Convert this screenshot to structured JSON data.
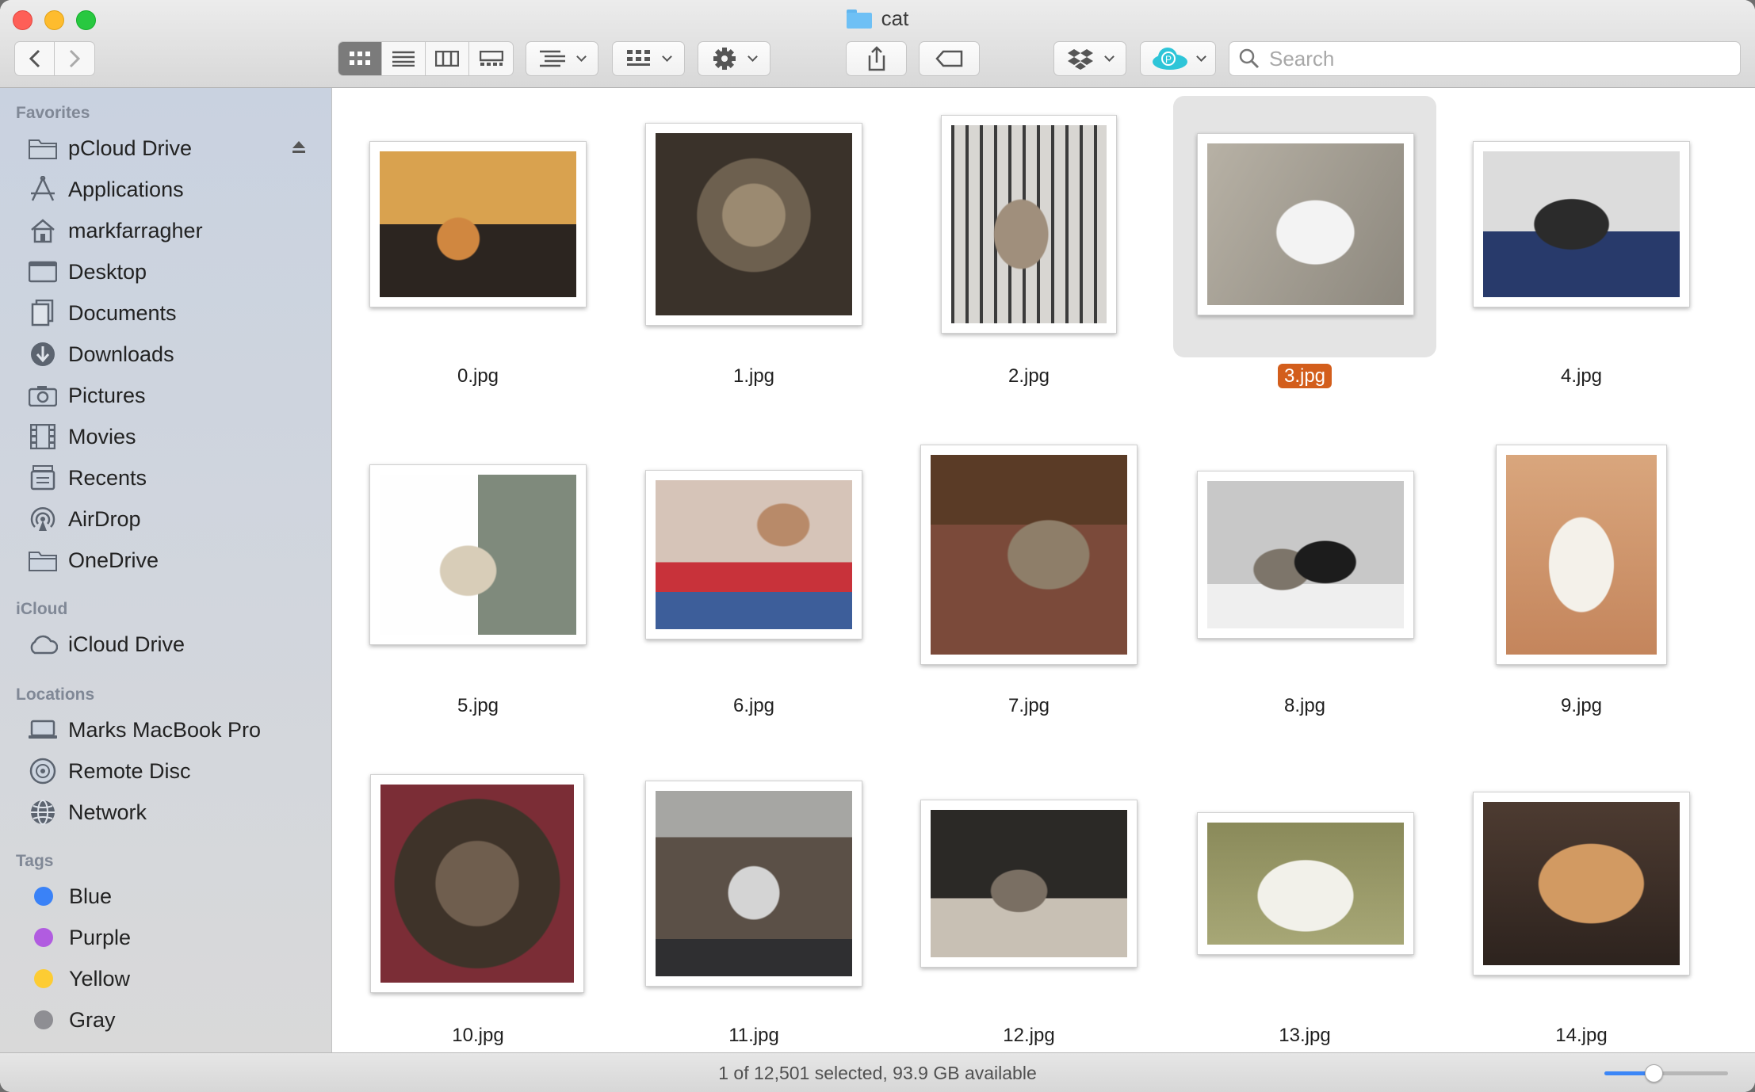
{
  "window": {
    "title": "cat"
  },
  "toolbar": {
    "back_icon": "chevron-left-icon",
    "forward_icon": "chevron-right-icon",
    "view_modes": [
      "icon-view-icon",
      "list-view-icon",
      "column-view-icon",
      "gallery-view-icon"
    ],
    "active_view": "icon",
    "group_icon": "group-by-icon",
    "arrange_icon": "arrange-icon",
    "action_icon": "gear-icon",
    "share_icon": "share-icon",
    "tag_icon": "tag-icon",
    "dropbox_icon": "dropbox-icon",
    "pcloud_icon": "pcloud-icon",
    "search_placeholder": "Search"
  },
  "sidebar": {
    "favorites_header": "Favorites",
    "favorites": [
      {
        "label": "pCloud Drive",
        "icon": "folder-icon"
      },
      {
        "label": "Applications",
        "icon": "applications-icon"
      },
      {
        "label": "markfarragher",
        "icon": "home-icon"
      },
      {
        "label": "Desktop",
        "icon": "desktop-icon"
      },
      {
        "label": "Documents",
        "icon": "document-icon"
      },
      {
        "label": "Downloads",
        "icon": "download-icon"
      },
      {
        "label": "Pictures",
        "icon": "camera-icon"
      },
      {
        "label": "Movies",
        "icon": "film-icon"
      },
      {
        "label": "Recents",
        "icon": "recents-icon"
      },
      {
        "label": "AirDrop",
        "icon": "airdrop-icon"
      },
      {
        "label": "OneDrive",
        "icon": "folder-icon"
      }
    ],
    "icloud_header": "iCloud",
    "icloud": [
      {
        "label": "iCloud Drive",
        "icon": "cloud-icon"
      }
    ],
    "locations_header": "Locations",
    "locations": [
      {
        "label": "Marks MacBook Pro",
        "icon": "laptop-icon"
      },
      {
        "label": "Remote Disc",
        "icon": "disc-icon"
      },
      {
        "label": "Network",
        "icon": "globe-icon"
      }
    ],
    "tags_header": "Tags",
    "tags": [
      {
        "label": "Blue",
        "color": "#3a82f7"
      },
      {
        "label": "Purple",
        "color": "#b15ce0"
      },
      {
        "label": "Yellow",
        "color": "#fdcc33"
      },
      {
        "label": "Gray",
        "color": "#8e8e93"
      }
    ]
  },
  "files": [
    {
      "name": "0.jpg",
      "selected": false
    },
    {
      "name": "1.jpg",
      "selected": false
    },
    {
      "name": "2.jpg",
      "selected": false
    },
    {
      "name": "3.jpg",
      "selected": true
    },
    {
      "name": "4.jpg",
      "selected": false
    },
    {
      "name": "5.jpg",
      "selected": false
    },
    {
      "name": "6.jpg",
      "selected": false
    },
    {
      "name": "7.jpg",
      "selected": false
    },
    {
      "name": "8.jpg",
      "selected": false
    },
    {
      "name": "9.jpg",
      "selected": false
    },
    {
      "name": "10.jpg",
      "selected": false
    },
    {
      "name": "11.jpg",
      "selected": false
    },
    {
      "name": "12.jpg",
      "selected": false
    },
    {
      "name": "13.jpg",
      "selected": false
    },
    {
      "name": "14.jpg",
      "selected": false
    }
  ],
  "status": {
    "text": "1 of 12,501 selected, 93.9 GB available"
  },
  "zoom_slider": {
    "value": 0.38
  },
  "colors": {
    "selection": "#d35e1c",
    "accent": "#3b86f7"
  }
}
